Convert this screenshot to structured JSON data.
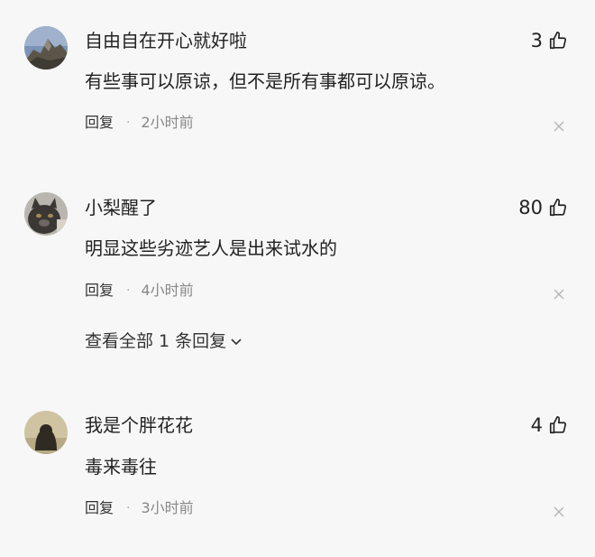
{
  "comments": [
    {
      "username": "自由自在开心就好啦",
      "likes": "3",
      "text": "有些事可以原谅，但不是所有事都可以原谅。",
      "reply_label": "回复",
      "separator": "·",
      "time": "2小时前"
    },
    {
      "username": "小梨醒了",
      "likes": "80",
      "text": "明显这些劣迹艺人是出来试水的",
      "reply_label": "回复",
      "separator": "·",
      "time": "4小时前",
      "view_replies": "查看全部 1 条回复"
    },
    {
      "username": "我是个胖花花",
      "likes": "4",
      "text": "毒来毒往",
      "reply_label": "回复",
      "separator": "·",
      "time": "3小时前"
    }
  ],
  "icons": {
    "like": "thumbs-up-icon",
    "close": "close-icon",
    "chevron": "chevron-down-icon"
  },
  "colors": {
    "background": "#f7f7f8",
    "text": "#222222",
    "muted": "#888888"
  }
}
